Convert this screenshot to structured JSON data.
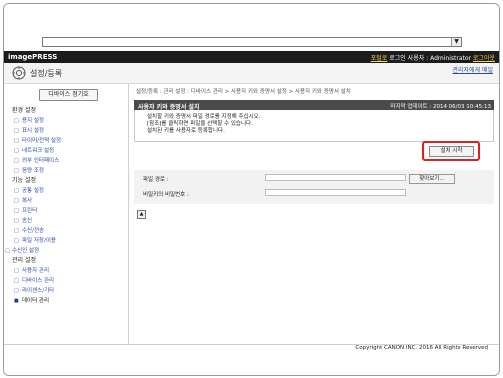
{
  "browser": {
    "address_value": "",
    "dropdown_icon": "▼"
  },
  "topbar": {
    "brand": "imagePRESS",
    "portal": "포털로",
    "login_user_label": "로그인 사용자 : Administrator",
    "logout": "로그아웃"
  },
  "header": {
    "title": "설정/등록",
    "to_admin": "관리자에게 메일",
    "icon": "settings-icon"
  },
  "sidebar": {
    "device_button": "디바이스 정기호",
    "items": [
      {
        "kind": "sec",
        "label": "환경 설정"
      },
      {
        "kind": "it",
        "label": "용지 설정"
      },
      {
        "kind": "it",
        "label": "표시 설정"
      },
      {
        "kind": "it",
        "label": "타이머/전력 설정"
      },
      {
        "kind": "it",
        "label": "네트워크 설정"
      },
      {
        "kind": "it",
        "label": "외부 인터페이스"
      },
      {
        "kind": "it",
        "label": "음량 조정"
      },
      {
        "kind": "sec",
        "label": "기능 설정"
      },
      {
        "kind": "it",
        "label": "공통 설정"
      },
      {
        "kind": "it",
        "label": "복사"
      },
      {
        "kind": "it",
        "label": "프린터"
      },
      {
        "kind": "it",
        "label": "송신"
      },
      {
        "kind": "it",
        "label": "수신/전송"
      },
      {
        "kind": "it",
        "label": "파일 저장/이용"
      },
      {
        "kind": "top",
        "label": "수신인 설정"
      },
      {
        "kind": "sec",
        "label": "관리 설정"
      },
      {
        "kind": "it",
        "label": "사용자 관리"
      },
      {
        "kind": "it",
        "label": "디바이스 관리"
      },
      {
        "kind": "it",
        "label": "라이센스/기타"
      },
      {
        "kind": "active",
        "label": "데이터 관리"
      }
    ]
  },
  "main": {
    "breadcrumb": "설정/등록 : 관리 설정 : 디바이스 관리 > 사용자 키와 증명서 설정 > 사용자 키와 증명서 설치",
    "panel_title": "사용자 키와 증명서 설치",
    "last_updated": "마지막 업데이트 : 2014 06/03 10:45:13",
    "description": [
      "설치할 키와 증명서 파일 경로를 지정해 주십시오.",
      "[참조]를 클릭하면 파일을 선택할 수 있습니다.",
      "설치된 키를 사용자로 등록합니다."
    ],
    "install_button": "설치 시작",
    "file_path_label": "파일 경로 :",
    "file_path_value": "",
    "browse_button": "찾아보기...",
    "private_key_label": "비밀키의 비밀번호 :",
    "private_key_value": "",
    "up_icon": "▲"
  },
  "footer": {
    "copyright": "Copyright CANON INC. 2016 All Rights Reserved"
  }
}
